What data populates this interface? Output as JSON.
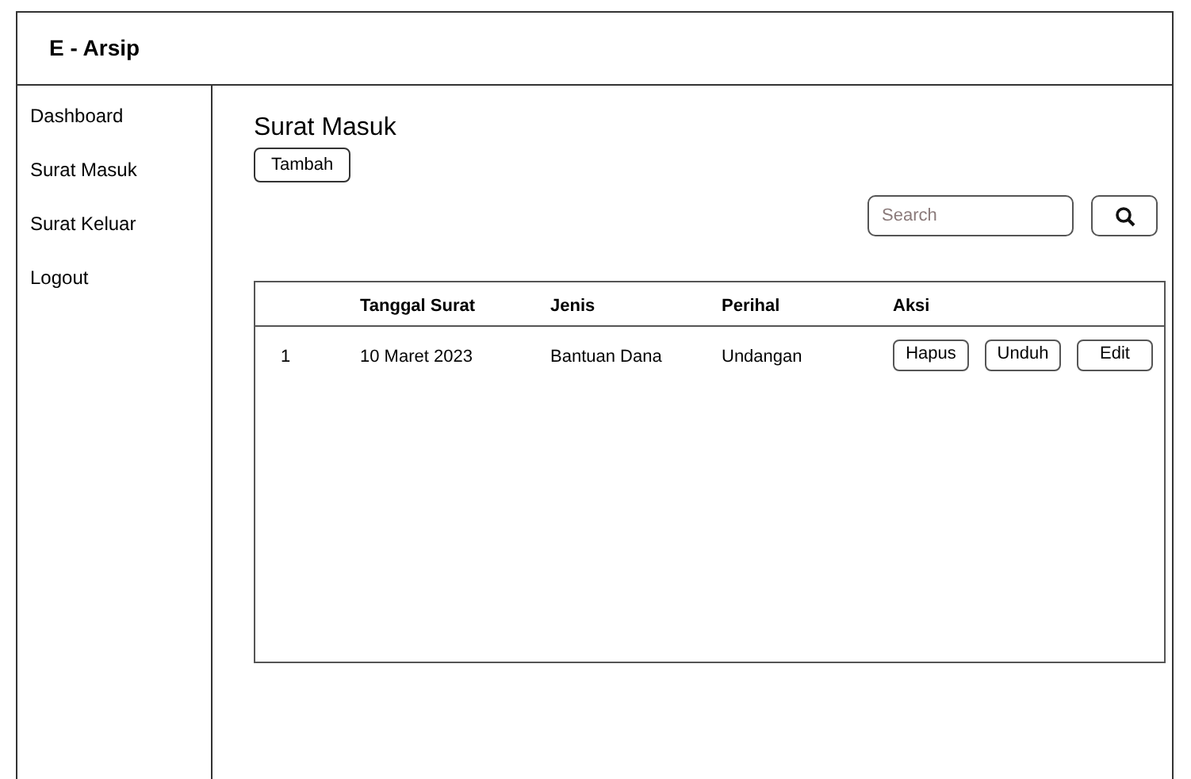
{
  "app_title": "E - Arsip",
  "sidebar": {
    "items": [
      "Dashboard",
      "Surat Masuk",
      "Surat Keluar",
      "Logout"
    ]
  },
  "page_title": "Surat Masuk",
  "add_button": "Tambah",
  "search": {
    "placeholder": "Search"
  },
  "table": {
    "columns": [
      "",
      "Tanggal Surat",
      "Jenis",
      "Perihal",
      "Aksi"
    ],
    "rows": [
      {
        "cells": [
          "1",
          "10 Maret 2023",
          "Bantuan Dana",
          "Undangan"
        ],
        "actions": [
          "Hapus",
          "Unduh",
          "Edit"
        ]
      }
    ]
  }
}
